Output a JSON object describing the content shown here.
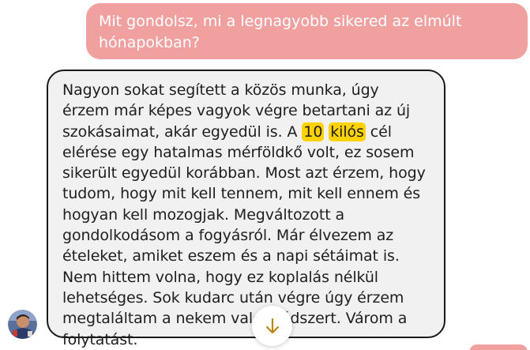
{
  "conversation": {
    "user_message": "Mit gondolsz, mi a legnagyobb sikered az elmúlt hónapokban?",
    "bot_message": {
      "part1": "Nagyon sokat segített a közös munka, úgy érzem már képes vagyok végre betartani az új szokásaimat, akár egyedül is. A ",
      "highlight1": "10",
      "highlight2": "kilós",
      "part2": " cél elérése egy hatalmas mérföldkő volt, ez sosem sikerült egyedül korábban. Most azt érzem, hogy tudom, hogy mit kell tennem, mit kell ennem és hogyan kell mozogjak. Megváltozott a gondolkodásom a fogyásról. Már élvezem az ételeket, amiket eszem és a napi sétáimat is. Nem hittem volna, hogy ez koplalás nélkül lehetséges. Sok kudarc után végre úgy érzem megtaláltam a nekem való módszert. Várom a folytatást."
    }
  },
  "icons": {
    "scroll_down": "arrow-down-icon",
    "avatar": "user-avatar"
  },
  "colors": {
    "user_bubble": "#efa09f",
    "bot_bubble": "#f1f1f1",
    "highlight": "#ffd200",
    "arrow": "#b8860b"
  }
}
